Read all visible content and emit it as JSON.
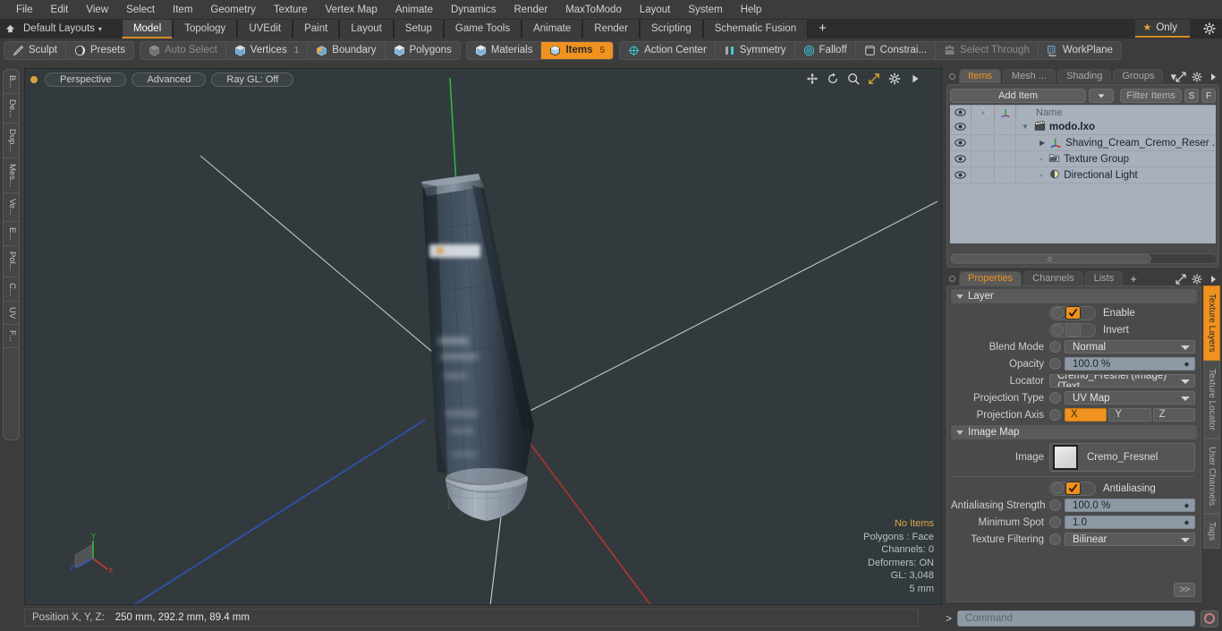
{
  "menu": {
    "items": [
      "File",
      "Edit",
      "View",
      "Select",
      "Item",
      "Geometry",
      "Texture",
      "Vertex Map",
      "Animate",
      "Dynamics",
      "Render",
      "MaxToModo",
      "Layout",
      "System",
      "Help"
    ]
  },
  "layout_bar": {
    "home_icon": "home-icon",
    "preset_label": "Default Layouts",
    "caret": "▾",
    "tabs": [
      {
        "label": "Model",
        "active": true
      },
      {
        "label": "Topology",
        "active": false
      },
      {
        "label": "UVEdit",
        "active": false
      },
      {
        "label": "Paint",
        "active": false
      },
      {
        "label": "Layout",
        "active": false
      },
      {
        "label": "Setup",
        "active": false
      },
      {
        "label": "Game Tools",
        "active": false
      },
      {
        "label": "Animate",
        "active": false
      },
      {
        "label": "Render",
        "active": false
      },
      {
        "label": "Scripting",
        "active": false
      },
      {
        "label": "Schematic Fusion",
        "active": false
      }
    ],
    "plus": "+",
    "only_label": "Only",
    "star_glyph": "★"
  },
  "toolbar": {
    "group1": [
      {
        "label": "Sculpt",
        "icon": "pencil-icon",
        "state": "normal",
        "count": ""
      },
      {
        "label": "Presets",
        "icon": "sphere-icon",
        "state": "normal",
        "count": ""
      }
    ],
    "group2": [
      {
        "label": "Auto Select",
        "icon": "cube-grey-icon",
        "state": "dim",
        "count": ""
      },
      {
        "label": "Vertices",
        "icon": "cube-vertices-icon",
        "state": "normal",
        "count": "1"
      },
      {
        "label": "Boundary",
        "icon": "cube-boundary-icon",
        "state": "normal",
        "count": ""
      },
      {
        "label": "Polygons",
        "icon": "cube-polygons-icon",
        "state": "normal",
        "count": ""
      }
    ],
    "group3": [
      {
        "label": "Materials",
        "icon": "cube-materials-icon",
        "state": "normal",
        "count": ""
      },
      {
        "label": "Items",
        "icon": "cube-items-icon",
        "state": "selected",
        "count": "5"
      }
    ],
    "group4": [
      {
        "label": "Action Center",
        "icon": "action-center-icon",
        "state": "normal",
        "count": ""
      },
      {
        "label": "Symmetry",
        "icon": "symmetry-icon",
        "state": "normal",
        "count": ""
      },
      {
        "label": "Falloff",
        "icon": "falloff-icon",
        "state": "normal",
        "count": ""
      },
      {
        "label": "Constrai...",
        "icon": "constraint-icon",
        "state": "normal",
        "count": ""
      },
      {
        "label": "Select Through",
        "icon": "select-through-icon",
        "state": "dim",
        "count": ""
      },
      {
        "label": "WorkPlane",
        "icon": "workplane-icon",
        "state": "normal",
        "count": ""
      }
    ]
  },
  "left_rail": {
    "tabs": [
      "B...",
      "De...",
      "Dup...",
      "Mes...",
      "Ve...",
      "E...",
      "Pol...",
      "C...",
      "UV",
      "F..."
    ]
  },
  "viewport": {
    "buttons": [
      "Perspective",
      "Advanced",
      "Ray GL: Off"
    ],
    "icons": [
      "move-icon",
      "rotate-icon",
      "zoom-icon",
      "fit-icon",
      "gear-icon",
      "play-icon"
    ],
    "stats": {
      "selection": "No Items",
      "polygons": "Polygons : Face",
      "channels": "Channels: 0",
      "deformers": "Deformers: ON",
      "gl": "GL: 3,048",
      "scale": "5 mm"
    },
    "gizmo_axes": [
      "X",
      "Y",
      "Z"
    ],
    "background_color": "#333a3d"
  },
  "items_panel": {
    "tabs": [
      {
        "label": "Items",
        "active": true
      },
      {
        "label": "Mesh ...",
        "active": false
      },
      {
        "label": "Shading",
        "active": false
      },
      {
        "label": "Groups",
        "active": false
      }
    ],
    "tab_caret": "▾",
    "add_item_label": "Add Item",
    "filter_placeholder": "Filter Items",
    "btn_s": "S",
    "btn_f": "F",
    "columns": [
      "eye-icon",
      "add-icon",
      "axis-icon",
      "Name"
    ],
    "rows": [
      {
        "name": "modo.lxo",
        "icon": "clapboard-icon",
        "indent": 0,
        "bold": true,
        "expander": "open"
      },
      {
        "name": "Shaving_Cream_Cremo_Reser ...",
        "icon": "locator-axis-icon",
        "indent": 1,
        "bold": false,
        "expander": "closed"
      },
      {
        "name": "Texture Group",
        "icon": "texture-group-icon",
        "indent": 1,
        "bold": false,
        "expander": "none"
      },
      {
        "name": "Directional Light",
        "icon": "light-icon",
        "indent": 1,
        "bold": false,
        "expander": "none"
      }
    ]
  },
  "properties_panel": {
    "tabs": [
      {
        "label": "Properties",
        "active": true
      },
      {
        "label": "Channels",
        "active": false
      },
      {
        "label": "Lists",
        "active": false
      }
    ],
    "plus": "+",
    "sections": {
      "layer": {
        "title": "Layer",
        "enable_label": "Enable",
        "enable_checked": true,
        "invert_label": "Invert",
        "invert_checked": false,
        "blend_mode_label": "Blend Mode",
        "blend_mode_value": "Normal",
        "opacity_label": "Opacity",
        "opacity_value": "100.0 %",
        "locator_label": "Locator",
        "locator_value": "Cremo_Fresnel (Image) (Text...",
        "projection_type_label": "Projection Type",
        "projection_type_value": "UV Map",
        "projection_axis_label": "Projection Axis",
        "projection_axis_options": [
          "X",
          "Y",
          "Z"
        ],
        "projection_axis_selected": "X"
      },
      "image_map": {
        "title": "Image Map",
        "image_label": "Image",
        "image_value": "Cremo_Fresnel",
        "antialiasing_label": "Antialiasing",
        "antialiasing_checked": true,
        "aa_strength_label": "Antialiasing Strength",
        "aa_strength_value": "100.0 %",
        "min_spot_label": "Minimum Spot",
        "min_spot_value": "1.0",
        "texture_filtering_label": "Texture Filtering",
        "texture_filtering_value": "Bilinear"
      }
    },
    "more_button": ">>"
  },
  "right_rail": {
    "tabs": [
      {
        "label": "Texture Layers",
        "active": true
      },
      {
        "label": "Texture Locator",
        "active": false
      },
      {
        "label": "User Channels",
        "active": false
      },
      {
        "label": "Tags",
        "active": false
      }
    ]
  },
  "status_bar": {
    "position_label": "Position X, Y, Z:",
    "position_value": "250 mm, 292.2 mm, 89.4 mm",
    "command_prompt": ">",
    "command_placeholder": "Command",
    "record_icon": "record-circle-icon"
  },
  "colors": {
    "accent": "#f0921f",
    "panel": "#3c3c3c",
    "list_bg": "#a7b0bb",
    "viewport_bg": "#333a3d"
  }
}
